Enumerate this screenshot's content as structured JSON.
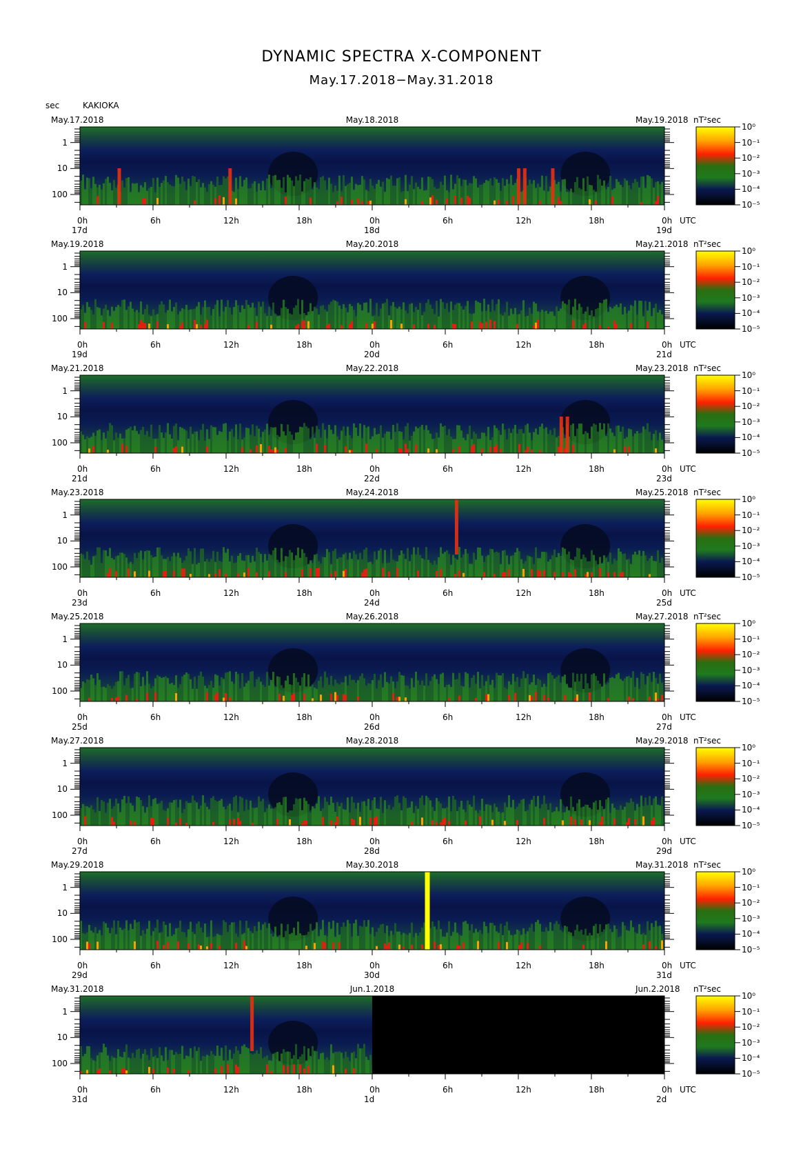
{
  "header": {
    "title": "DYNAMIC SPECTRA X-COMPONENT",
    "subtitle": "May.17.2018−May.31.2018",
    "unit_label": "sec",
    "station": "KAKIOKA"
  },
  "chart_data": {
    "type": "heatmap",
    "y_axis": {
      "label": "sec",
      "scale": "log",
      "tick_labels": [
        "1",
        "10",
        "100"
      ],
      "range": [
        0.25,
        250
      ],
      "inverted": true
    },
    "x_tick_labels": [
      "0h",
      "6h",
      "12h",
      "18h",
      "0h",
      "6h",
      "12h",
      "18h",
      "0h"
    ],
    "utc_label": "UTC",
    "colorbar": {
      "unit": "nT²sec",
      "tick_labels": [
        "10⁰",
        "10⁻¹",
        "10⁻²",
        "10⁻³",
        "10⁻⁴",
        "10⁻⁵"
      ],
      "colors": [
        "#ffff00",
        "#ffa500",
        "#ff2000",
        "#208000",
        "#0a1a50",
        "#000000"
      ]
    },
    "panels": [
      {
        "start_date": "May.17.2018",
        "mid_date": "May.18.2018",
        "end_date": "May.19.2018",
        "day_labels": [
          "17d",
          "18d",
          "19d"
        ],
        "data_fraction": 1.0,
        "bursts": [
          [
            3.2,
            2
          ],
          [
            12.3,
            2
          ],
          [
            36.0,
            3
          ],
          [
            36.5,
            3
          ],
          [
            38.8,
            3
          ]
        ],
        "gap_hours": []
      },
      {
        "start_date": "May.19.2018",
        "mid_date": "May.20.2018",
        "end_date": "May.21.2018",
        "day_labels": [
          "19d",
          "20d",
          "21d"
        ],
        "data_fraction": 1.0,
        "bursts": [],
        "gap_hours": []
      },
      {
        "start_date": "May.21.2018",
        "mid_date": "May.22.2018",
        "end_date": "May.23.2018",
        "day_labels": [
          "21d",
          "22d",
          "23d"
        ],
        "data_fraction": 1.0,
        "bursts": [
          [
            39.5,
            3
          ],
          [
            40.0,
            3
          ]
        ],
        "gap_hours": []
      },
      {
        "start_date": "May.23.2018",
        "mid_date": "May.24.2018",
        "end_date": "May.25.2018",
        "day_labels": [
          "23d",
          "24d",
          "25d"
        ],
        "data_fraction": 1.0,
        "bursts": [
          [
            30.9,
            1
          ]
        ],
        "gap_hours": []
      },
      {
        "start_date": "May.25.2018",
        "mid_date": "May.26.2018",
        "end_date": "May.27.2018",
        "day_labels": [
          "25d",
          "26d",
          "27d"
        ],
        "data_fraction": 1.0,
        "bursts": [],
        "gap_hours": []
      },
      {
        "start_date": "May.27.2018",
        "mid_date": "May.28.2018",
        "end_date": "May.29.2018",
        "day_labels": [
          "27d",
          "28d",
          "29d"
        ],
        "data_fraction": 1.0,
        "bursts": [],
        "gap_hours": []
      },
      {
        "start_date": "May.29.2018",
        "mid_date": "May.30.2018",
        "end_date": "May.31.2018",
        "day_labels": [
          "29d",
          "30d",
          "31d"
        ],
        "data_fraction": 1.0,
        "bursts": [],
        "gap_hours": [
          28.5
        ]
      },
      {
        "start_date": "May.31.2018",
        "mid_date": "Jun.1.2018",
        "end_date": "Jun.2.2018",
        "day_labels": [
          "31d",
          "1d",
          "2d"
        ],
        "data_fraction": 0.5,
        "bursts": [
          [
            14.1,
            1
          ]
        ],
        "gap_hours": []
      }
    ]
  }
}
